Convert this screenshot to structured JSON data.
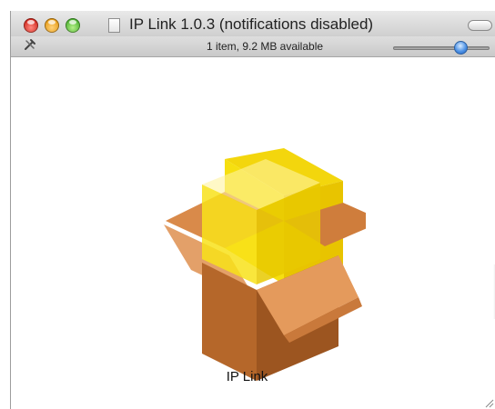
{
  "window": {
    "title": "IP Link 1.0.3 (notifications disabled)",
    "buttons": [
      "close",
      "minimize",
      "zoom"
    ]
  },
  "statusbar": {
    "text": "1 item, 9.2 MB available",
    "action_icon": "tools-icon",
    "zoom_level": 0.7
  },
  "content": {
    "items": [
      {
        "label": "IP Link",
        "icon": "package-icon"
      }
    ]
  },
  "colors": {
    "box_brown": "#c47a3c",
    "box_yellow": "#f6e013",
    "selection_blue": "#4f93e6"
  }
}
